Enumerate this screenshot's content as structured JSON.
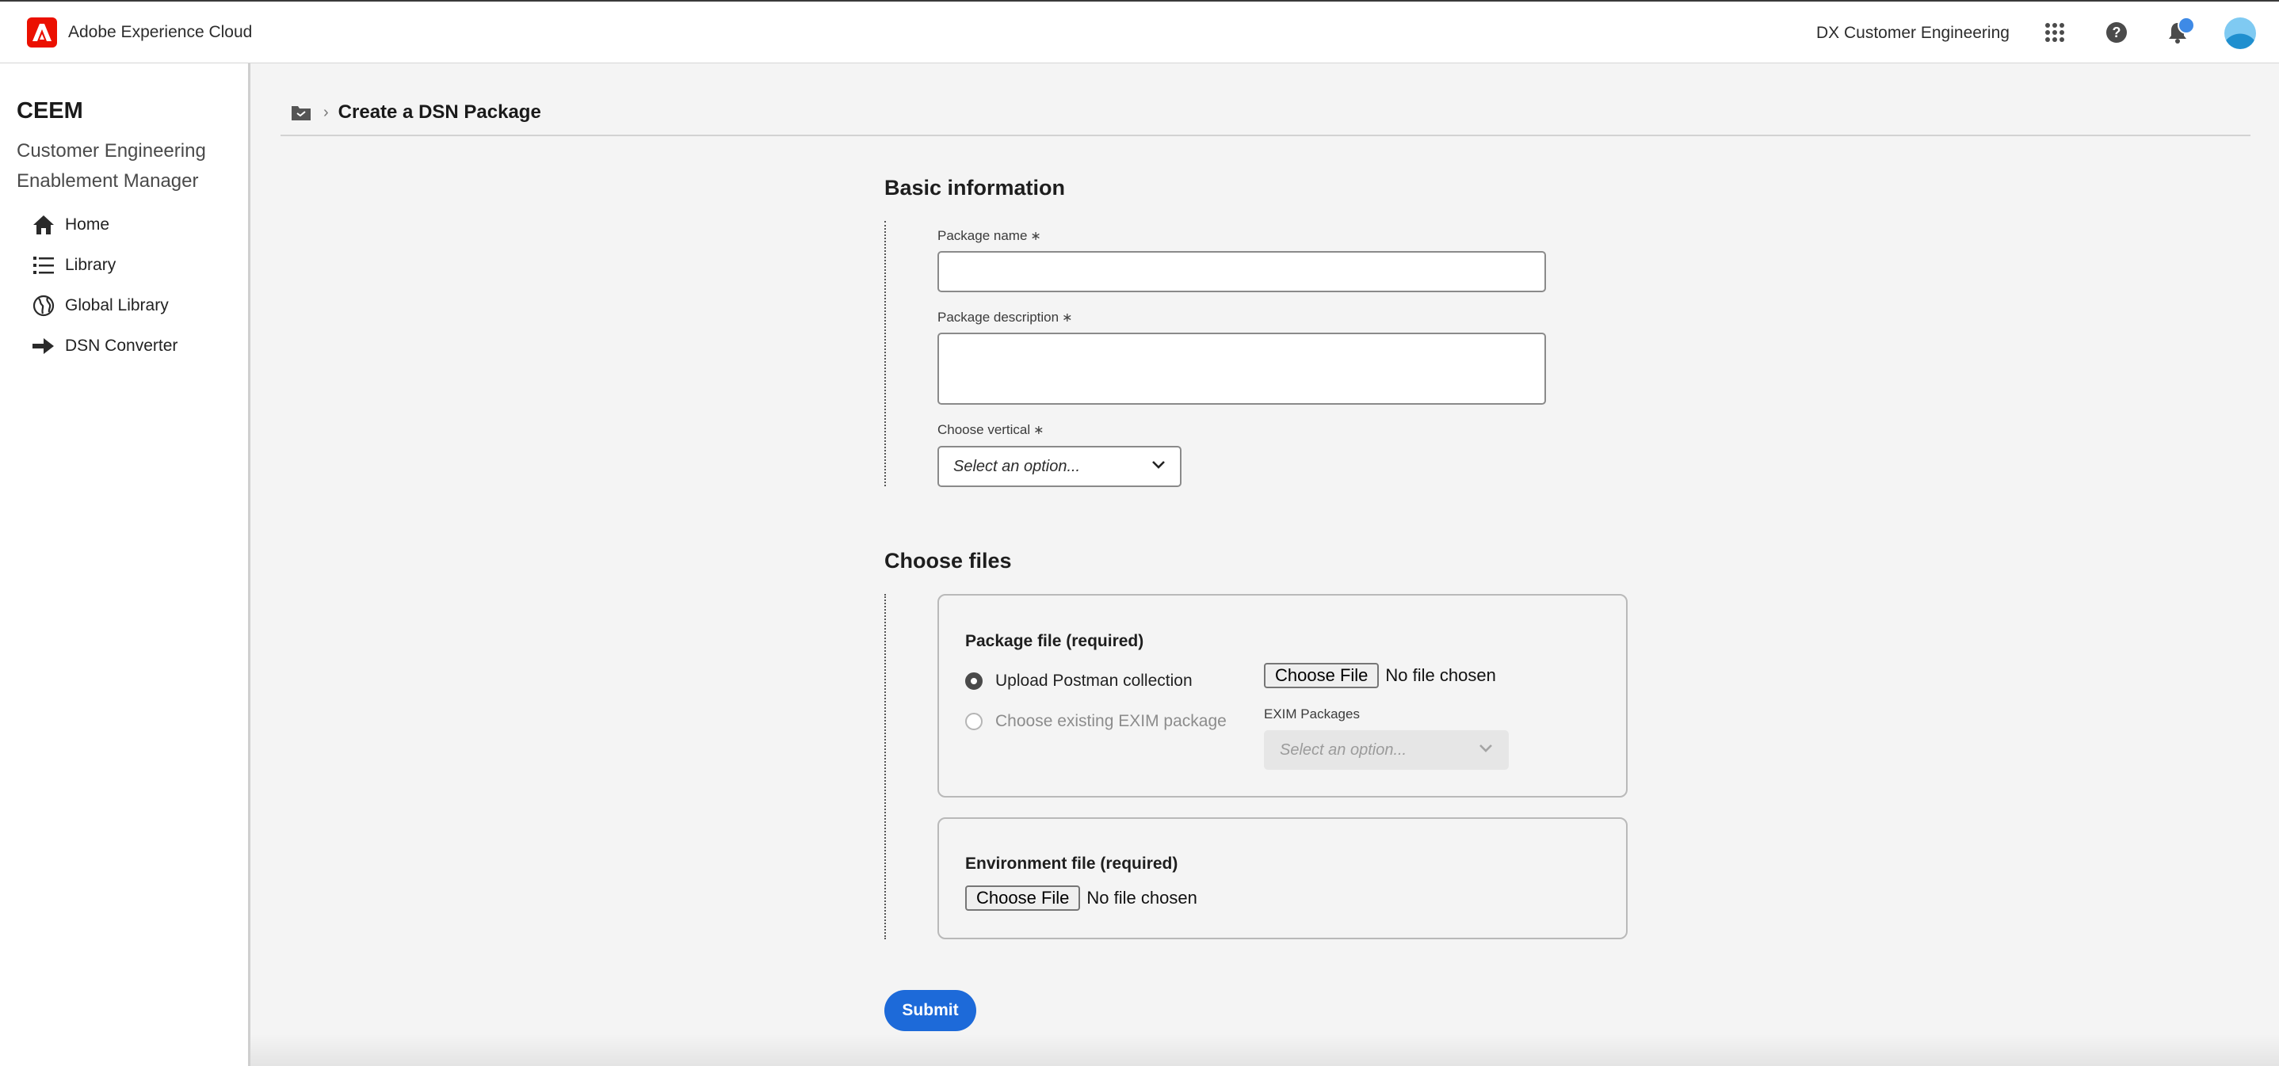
{
  "topbar": {
    "brand_name": "Adobe Experience Cloud",
    "org_name": "DX Customer Engineering",
    "icons": [
      "adobe-logo-icon",
      "apps-grid-icon",
      "help-icon",
      "bell-icon",
      "avatar"
    ],
    "colors": {
      "brand": "#eb1000",
      "notification_dot": "#3e8ae6"
    }
  },
  "sidebar": {
    "app_short": "CEEM",
    "app_long": "Customer Engineering Enablement Manager",
    "items": [
      {
        "label": "Home",
        "icon": "home-icon"
      },
      {
        "label": "Library",
        "icon": "list-icon"
      },
      {
        "label": "Global Library",
        "icon": "globe-icon"
      },
      {
        "label": "DSN Converter",
        "icon": "arrow-right-icon"
      }
    ]
  },
  "breadcrumb": {
    "icon": "folder-icon",
    "separator": "›",
    "current": "Create a DSN Package"
  },
  "basic_info": {
    "title": "Basic information",
    "package_name": {
      "label": "Package name",
      "required": "∗",
      "value": ""
    },
    "package_description": {
      "label": "Package description",
      "required": "∗",
      "value": ""
    },
    "vertical": {
      "label": "Choose vertical",
      "required": "∗",
      "placeholder": "Select an option..."
    }
  },
  "choose_files": {
    "title": "Choose files",
    "package_file": {
      "title": "Package file (required)",
      "options": [
        {
          "label": "Upload Postman collection",
          "selected": true,
          "disabled": false
        },
        {
          "label": "Choose existing EXIM package",
          "selected": false,
          "disabled": true
        }
      ],
      "file_button": "Choose File",
      "file_status": "No file chosen",
      "exim_label": "EXIM Packages",
      "exim_placeholder": "Select an option..."
    },
    "environment_file": {
      "title": "Environment file (required)",
      "file_button": "Choose File",
      "file_status": "No file chosen"
    }
  },
  "submit": {
    "label": "Submit",
    "color": "#1d6ad9"
  }
}
